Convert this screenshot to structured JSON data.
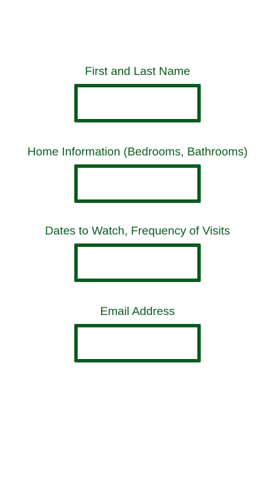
{
  "theme": {
    "accent": "#0b5a1e",
    "background": "#ffffff"
  },
  "form": {
    "fields": [
      {
        "label": "First and Last Name",
        "value": ""
      },
      {
        "label": "Home Information (Bedrooms, Bathrooms)",
        "value": ""
      },
      {
        "label": "Dates to Watch, Frequency of Visits",
        "value": ""
      },
      {
        "label": "Email Address",
        "value": ""
      }
    ]
  }
}
